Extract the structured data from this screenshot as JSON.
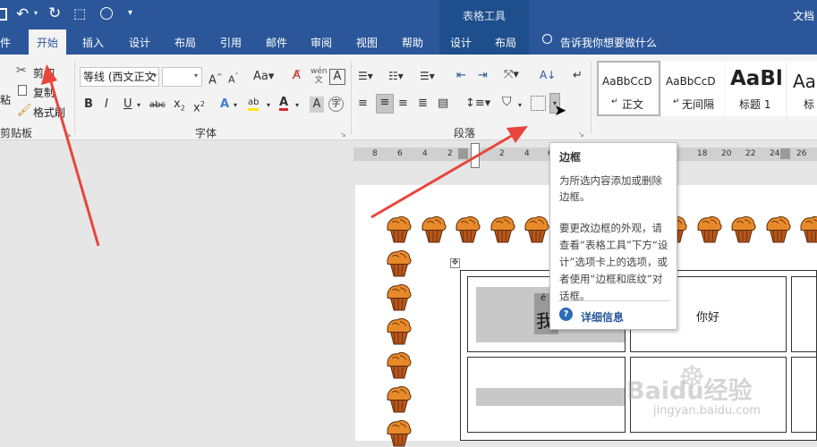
{
  "titlebar": {
    "context_tab_group": "表格工具",
    "doc_title": "文档"
  },
  "tabs": [
    {
      "label": "件"
    },
    {
      "label": "开始"
    },
    {
      "label": "插入"
    },
    {
      "label": "设计"
    },
    {
      "label": "布局"
    },
    {
      "label": "引用"
    },
    {
      "label": "邮件"
    },
    {
      "label": "审阅"
    },
    {
      "label": "视图"
    },
    {
      "label": "帮助"
    },
    {
      "label": "设计"
    },
    {
      "label": "布局"
    }
  ],
  "tell_me": "告诉我你想要做什么",
  "clipboard": {
    "paste": "粘",
    "cut": "剪切",
    "copy": "复制",
    "format_painter": "格式刷",
    "group_label": "剪贴板"
  },
  "font": {
    "font_name": "等线 (西文正文",
    "font_size": "",
    "group_label": "字体"
  },
  "paragraph": {
    "group_label": "段落"
  },
  "styles": [
    {
      "preview": "AaBbCcD",
      "name": "正文"
    },
    {
      "preview": "AaBbCcD",
      "name": "无间隔"
    },
    {
      "preview": "AaBl",
      "name": "标题 1"
    },
    {
      "preview": "Aa",
      "name": "标"
    }
  ],
  "ruler_numbers": [
    "8",
    "6",
    "4",
    "2",
    "2",
    "4",
    "6",
    "18",
    "20",
    "22",
    "24",
    "26"
  ],
  "tooltip": {
    "title": "边框",
    "desc": "为所选内容添加或删除边框。",
    "detail": "要更改边框的外观，请查看“表格工具”下方“设计”选项卡上的选项，或者使用“边框和底纹”对话框。",
    "link": "详细信息"
  },
  "table": {
    "cell_text_1": "我",
    "cell_text_1_ruby": "é",
    "cell_text_2": "你好"
  },
  "watermark": {
    "logo": "Baidu经验",
    "url": "jingyan.baidu.com"
  },
  "colors": {
    "title_blue": "#2b579a",
    "arrow_red": "#e8453c",
    "font_color_red": "#d9262a",
    "highlight_yellow": "#ffe600"
  }
}
